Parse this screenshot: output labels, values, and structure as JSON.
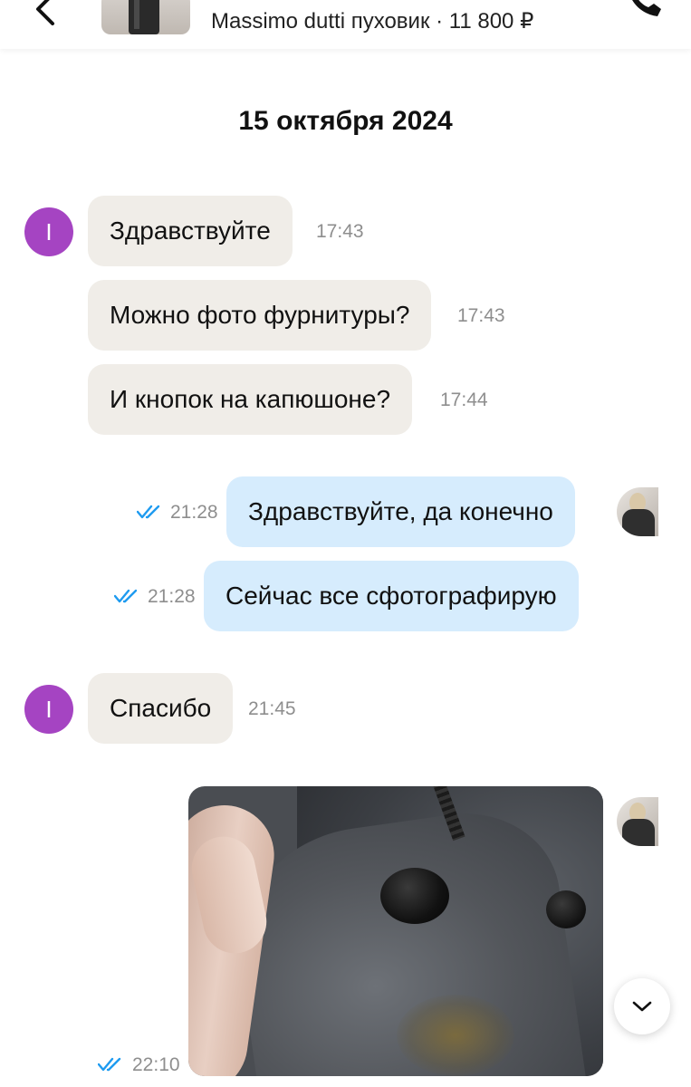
{
  "header": {
    "product_title": "Massimo dutti пуховик · 11 800 ₽"
  },
  "chat": {
    "date_separator": "15 октября 2024",
    "incoming_avatar_letter": "I",
    "messages": [
      {
        "side": "in",
        "text": "Здравствуйте",
        "time": "17:43"
      },
      {
        "side": "in",
        "text": "Можно фото фурнитуры?",
        "time": "17:43"
      },
      {
        "side": "in",
        "text": "И кнопок на капюшоне?",
        "time": "17:44"
      },
      {
        "side": "out",
        "text": "Здравствуйте, да конечно",
        "time": "21:28",
        "status": "read"
      },
      {
        "side": "out",
        "text": "Сейчас все сфотографирую",
        "time": "21:28",
        "status": "read"
      },
      {
        "side": "in",
        "text": "Спасибо",
        "time": "21:45"
      },
      {
        "side": "out",
        "type": "photo",
        "time": "22:10",
        "status": "read"
      }
    ]
  },
  "icons": {
    "back": "arrow-left-icon",
    "call": "phone-icon",
    "read_status": "double-check-icon",
    "scroll": "chevron-down-icon"
  },
  "colors": {
    "incoming_bubble": "#f0ede8",
    "outgoing_bubble": "#d6ecfd",
    "avatar_purple": "#a544c2",
    "check_blue": "#1e9bf0"
  }
}
